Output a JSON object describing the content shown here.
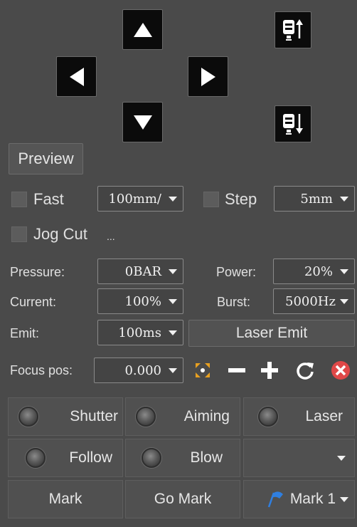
{
  "jog": {
    "up": "arrow-up-icon",
    "down": "arrow-down-icon",
    "left": "arrow-left-icon",
    "right": "arrow-right-icon",
    "z_up": "laser-head-up-icon",
    "z_down": "laser-head-down-icon"
  },
  "preview_label": "Preview",
  "fast": {
    "label": "Fast",
    "value": "100mm/"
  },
  "step": {
    "label": "Step",
    "value": "5mm"
  },
  "jog_cut": {
    "label": "Jog Cut",
    "more": "..."
  },
  "pressure": {
    "label": "Pressure:",
    "value": "0BAR"
  },
  "power": {
    "label": "Power:",
    "value": "20%"
  },
  "current": {
    "label": "Current:",
    "value": "100%"
  },
  "burst": {
    "label": "Burst:",
    "value": "5000Hz"
  },
  "emit": {
    "label": "Emit:",
    "value": "100ms"
  },
  "laser_emit_label": "Laser Emit",
  "focus": {
    "label": "Focus pos:",
    "value": "0.000"
  },
  "status": {
    "shutter": "Shutter",
    "aiming": "Aiming",
    "laser": "Laser",
    "follow": "Follow",
    "blow": "Blow"
  },
  "mark_label": "Mark",
  "go_mark_label": "Go Mark",
  "mark_select": "Mark 1",
  "colors": {
    "background": "#4a4a4a",
    "button": "#505050",
    "flag": "#2f7fe0",
    "close": "#e04848"
  }
}
